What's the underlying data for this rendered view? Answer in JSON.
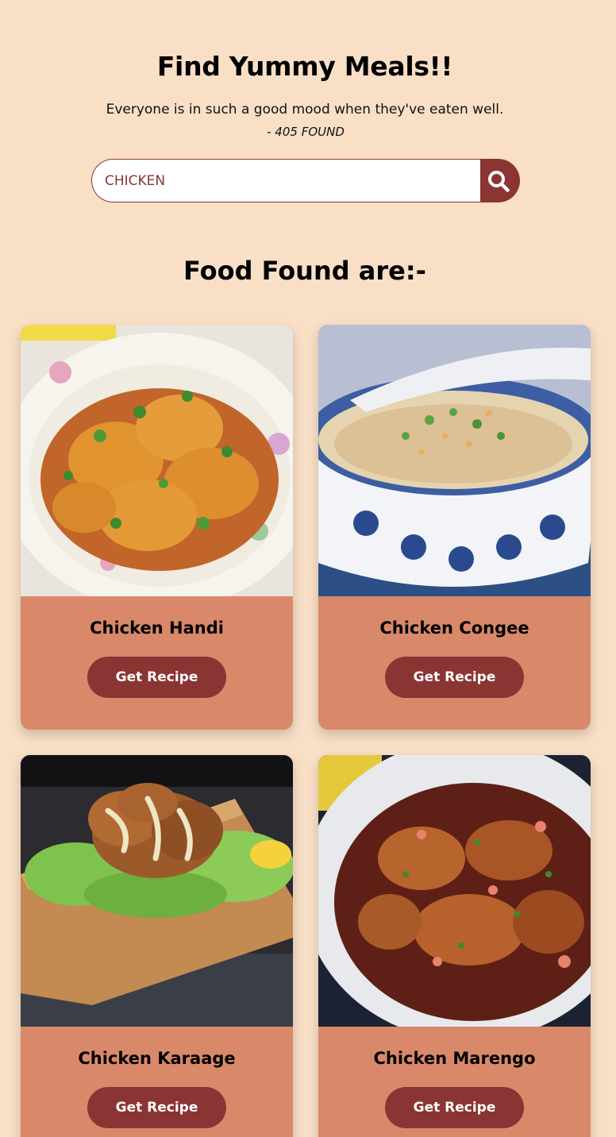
{
  "header": {
    "title": "Find Yummy Meals!!",
    "tagline": "Everyone is in such a good mood when they've eaten well.",
    "found_text": "- 405 FOUND"
  },
  "search": {
    "value": "CHICKEN",
    "icon": "search-icon"
  },
  "results": {
    "title": "Food Found are:-",
    "button_label": "Get Recipe",
    "meals": [
      {
        "name": "Chicken Handi"
      },
      {
        "name": "Chicken Congee"
      },
      {
        "name": "Chicken Karaage"
      },
      {
        "name": "Chicken Marengo"
      }
    ]
  },
  "colors": {
    "background": "#f8dfc6",
    "card": "#d9896a",
    "accent": "#8b3434"
  }
}
